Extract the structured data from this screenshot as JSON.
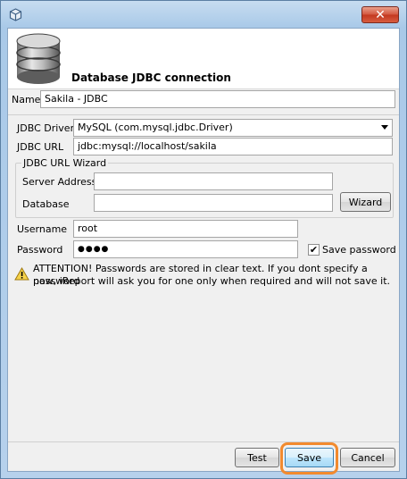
{
  "window": {
    "title": "",
    "close_glyph": "✕",
    "icon": "app-cube-icon"
  },
  "header": {
    "title": "Database JDBC connection",
    "icon": "database-icon"
  },
  "form": {
    "name_label": "Name",
    "name_value": "Sakila - JDBC",
    "driver_label": "JDBC Driver",
    "driver_value": "MySQL (com.mysql.jdbc.Driver)",
    "url_label": "JDBC URL",
    "url_value": "jdbc:mysql://localhost/sakila",
    "wizard_group_title": "JDBC URL Wizard",
    "server_label": "Server Address",
    "server_value": "",
    "database_label": "Database",
    "database_value": "",
    "wizard_button": "Wizard",
    "username_label": "Username",
    "username_value": "root",
    "password_label": "Password",
    "password_value": "●●●●",
    "save_password_label": "Save password",
    "save_password_checked": "✔",
    "warning_line1": "ATTENTION! Passwords are stored in clear text. If you dont specify a password",
    "warning_line2": "now, iReport will ask you for one only when required and will not save it.",
    "warning_icon": "warning-icon"
  },
  "buttons": {
    "test": "Test",
    "save": "Save",
    "cancel": "Cancel"
  },
  "colors": {
    "highlight": "#f28a2e",
    "close_button": "#c7432a"
  }
}
